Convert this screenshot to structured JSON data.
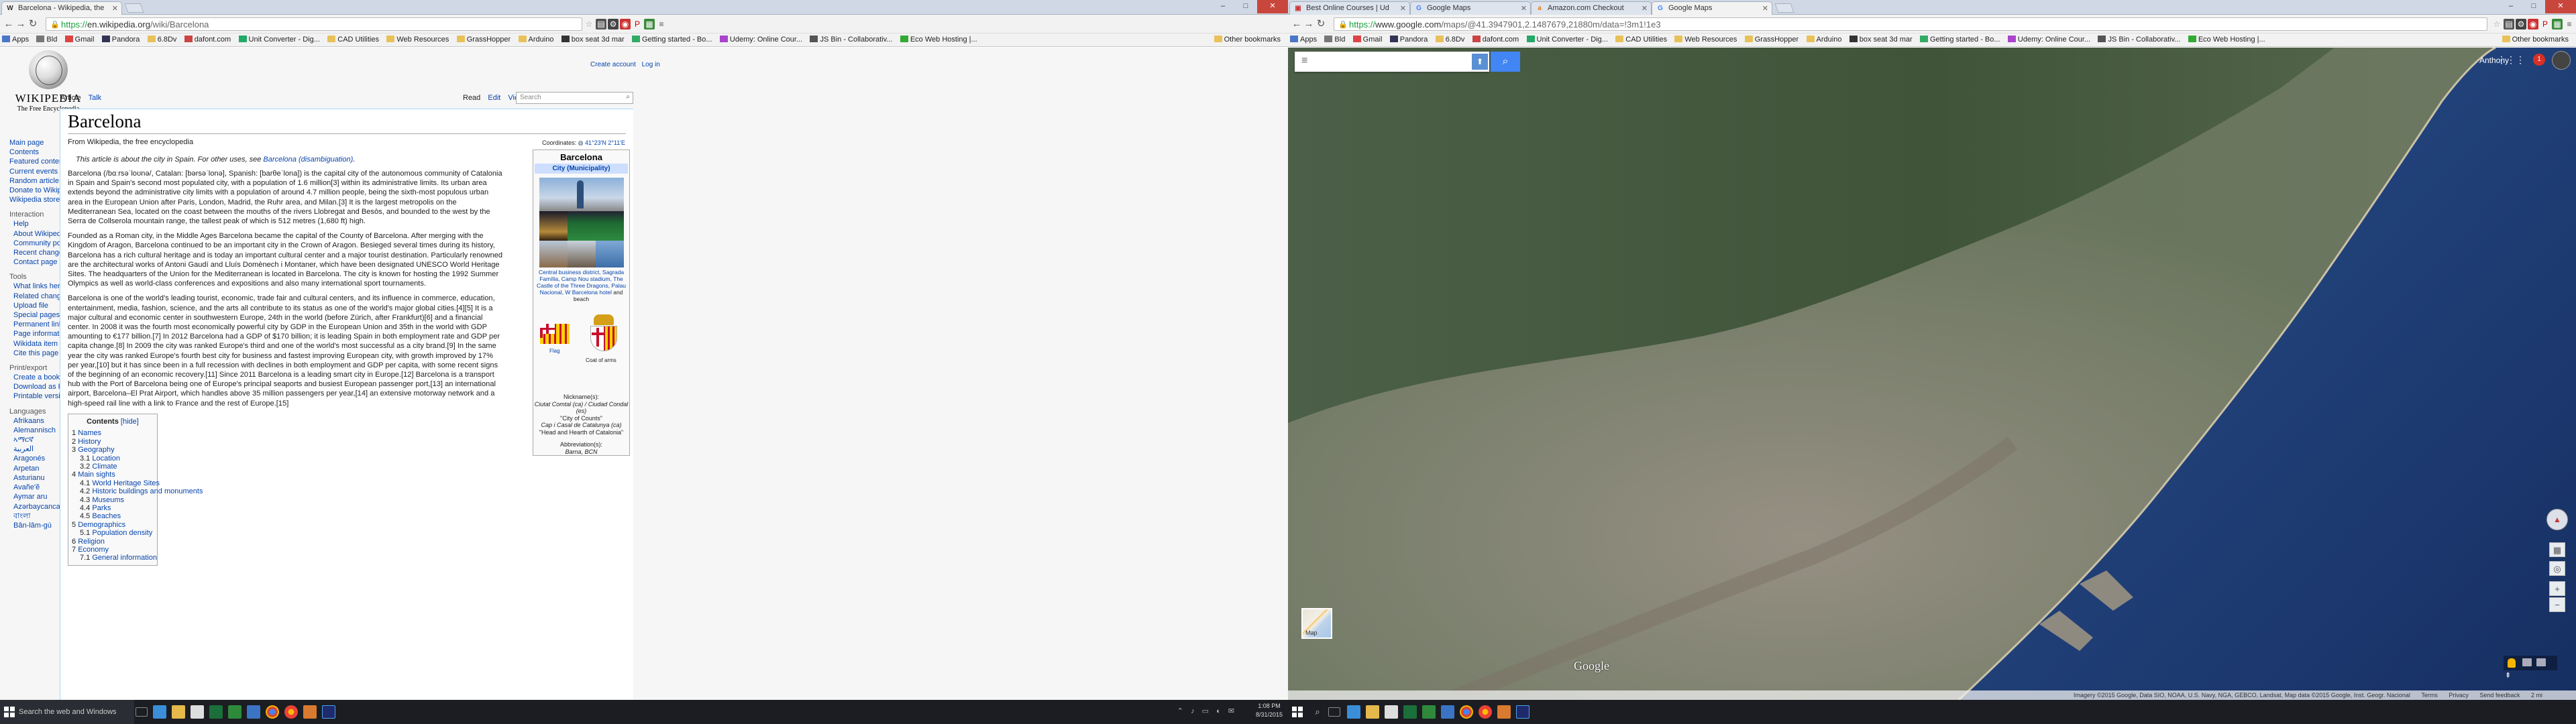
{
  "left_window": {
    "tab": {
      "title": "Barcelona - Wikipedia, the",
      "favicon": "W"
    },
    "window_controls": [
      "–",
      "□",
      "✕"
    ],
    "nav": {
      "back": "←",
      "forward": "→",
      "reload": "↻",
      "home": "⌂"
    },
    "url": {
      "scheme": "https://",
      "host": "en.wikipedia.org",
      "path": "/wiki/Barcelona"
    },
    "bookmarks": [
      "Apps",
      "Bld",
      "Gmail",
      "Pandora",
      "6.8Dv",
      "dafont.com",
      "Unit Converter - Dig...",
      "CAD Utilities",
      "Web Resources",
      "GrassHopper",
      "Arduino",
      "box seat 3d mar",
      "Getting started - Bo...",
      "Udemy: Online Cour...",
      "JS Bin - Collaborativ...",
      "Eco Web Hosting |...",
      "Other bookmarks"
    ],
    "wiki": {
      "logo_wordmark": "WIKIPEDIA",
      "logo_sub": "The Free Encyclopedia",
      "personal": [
        "Create account",
        "Log in"
      ],
      "tabs_left": [
        "Article",
        "Talk"
      ],
      "tabs_right": [
        "Read",
        "Edit",
        "View history"
      ],
      "search_placeholder": "Search",
      "nav_main": [
        "Main page",
        "Contents",
        "Featured content",
        "Current events",
        "Random article",
        "Donate to Wikipedia",
        "Wikipedia store"
      ],
      "interaction_head": "Interaction",
      "nav_interaction": [
        "Help",
        "About Wikipedia",
        "Community portal",
        "Recent changes",
        "Contact page"
      ],
      "tools_head": "Tools",
      "nav_tools": [
        "What links here",
        "Related changes",
        "Upload file",
        "Special pages",
        "Permanent link",
        "Page information",
        "Wikidata item",
        "Cite this page"
      ],
      "print_head": "Print/export",
      "nav_print": [
        "Create a book",
        "Download as PDF",
        "Printable version"
      ],
      "lang_head": "Languages",
      "nav_langs": [
        "Afrikaans",
        "Alemannisch",
        "ኣማርኛ",
        "العربية",
        "Aragonés",
        "Arpetan",
        "Asturianu",
        "Avañe'ẽ",
        "Aymar aru",
        "Azərbaycanca",
        "বাংলা",
        "Bân-lâm-gú"
      ],
      "title": "Barcelona",
      "from": "From Wikipedia, the free encyclopedia",
      "coords_label": "Coordinates:",
      "coords_value": "41°23′N 2°11′E",
      "hatnote_a": "This article is about the city in Spain. For other uses, see ",
      "hatnote_link": "Barcelona (disambiguation)",
      "para1": "Barcelona (/bɑːrsəˈloʊnə/, Catalan: [bərsəˈlonə], Spanish: [barθeˈlona]) is the capital city of the autonomous community of Catalonia in Spain and Spain's second most populated city, with a population of 1.6 million[3] within its administrative limits. Its urban area extends beyond the administrative city limits with a population of around 4.7 million people, being the sixth-most populous urban area in the European Union after Paris, London, Madrid, the Ruhr area, and Milan.[3] It is the largest metropolis on the Mediterranean Sea, located on the coast between the mouths of the rivers Llobregat and Besòs, and bounded to the west by the Serra de Collserola mountain range, the tallest peak of which is 512 metres (1,680 ft) high.",
      "para2": "Founded as a Roman city, in the Middle Ages Barcelona became the capital of the County of Barcelona. After merging with the Kingdom of Aragon, Barcelona continued to be an important city in the Crown of Aragon. Besieged several times during its history, Barcelona has a rich cultural heritage and is today an important cultural center and a major tourist destination. Particularly renowned are the architectural works of Antoni Gaudí and Lluís Domènech i Montaner, which have been designated UNESCO World Heritage Sites. The headquarters of the Union for the Mediterranean is located in Barcelona. The city is known for hosting the 1992 Summer Olympics as well as world-class conferences and expositions and also many international sport tournaments.",
      "para3": "Barcelona is one of the world's leading tourist, economic, trade fair and cultural centers, and its influence in commerce, education, entertainment, media, fashion, science, and the arts all contribute to its status as one of the world's major global cities.[4][5] It is a major cultural and economic center in southwestern Europe, 24th in the world (before Zürich, after Frankfurt)[6] and a financial center. In 2008 it was the fourth most economically powerful city by GDP in the European Union and 35th in the world with GDP amounting to €177 billion.[7] In 2012 Barcelona had a GDP of $170 billion; it is leading Spain in both employment rate and GDP per capita change.[8] In 2009 the city was ranked Europe's third and one of the world's most successful as a city brand.[9] In the same year the city was ranked Europe's fourth best city for business and fastest improving European city, with growth improved by 17% per year,[10] but it has since been in a full recession with declines in both employment and GDP per capita, with some recent signs of the beginning of an economic recovery.[11] Since 2011 Barcelona is a leading smart city in Europe.[12] Barcelona is a transport hub with the Port of Barcelona being one of Europe's principal seaports and busiest European passenger port,[13] an international airport, Barcelona–El Prat Airport, which handles above 35 million passengers per year,[14] an extensive motorway network and a high-speed rail line with a link to France and the rest of Europe.[15]",
      "toc_title": "Contents",
      "toc_hide": "[hide]",
      "toc": [
        {
          "n": "1",
          "t": "Names",
          "lv": 1
        },
        {
          "n": "2",
          "t": "History",
          "lv": 1
        },
        {
          "n": "3",
          "t": "Geography",
          "lv": 1
        },
        {
          "n": "3.1",
          "t": "Location",
          "lv": 2
        },
        {
          "n": "3.2",
          "t": "Climate",
          "lv": 2
        },
        {
          "n": "4",
          "t": "Main sights",
          "lv": 1
        },
        {
          "n": "4.1",
          "t": "World Heritage Sites",
          "lv": 2
        },
        {
          "n": "4.2",
          "t": "Historic buildings and monuments",
          "lv": 2
        },
        {
          "n": "4.3",
          "t": "Museums",
          "lv": 2
        },
        {
          "n": "4.4",
          "t": "Parks",
          "lv": 2
        },
        {
          "n": "4.5",
          "t": "Beaches",
          "lv": 2
        },
        {
          "n": "5",
          "t": "Demographics",
          "lv": 1
        },
        {
          "n": "5.1",
          "t": "Population density",
          "lv": 2
        },
        {
          "n": "6",
          "t": "Religion",
          "lv": 1
        },
        {
          "n": "7",
          "t": "Economy",
          "lv": 1
        },
        {
          "n": "7.1",
          "t": "General information",
          "lv": 2
        }
      ],
      "infobox": {
        "title": "Barcelona",
        "type": "City (Municipality)",
        "caption": "Central business district, Sagrada Família, Camp Nou stadium, The Castle of the Three Dragons, Palau Nacional, W Barcelona hotel",
        "caption_tail": "and beach",
        "flag_label": "Flag",
        "coa_label": "Coat of arms",
        "nick_head": "Nickname(s):",
        "nick1": "Ciutat Comtal (ca) / Ciudad Condal (es)",
        "nick2": "\"City of Counts\"",
        "nick3": "Cap i Casal de Catalunya (ca)",
        "nick4": "\"Head and Hearth of Catalonia\"",
        "abbr_head": "Abbreviation(s):",
        "abbr": "Barna, BCN"
      }
    }
  },
  "right_window": {
    "tabs": [
      {
        "title": "Best Online Courses | Ud",
        "favicon": "▣"
      },
      {
        "title": "Google Maps",
        "favicon": "G"
      },
      {
        "title": "Amazon.com Checkout",
        "favicon": "a"
      },
      {
        "title": "Google Maps",
        "favicon": "G"
      }
    ],
    "url": {
      "scheme": "https://",
      "host": "www.google.com",
      "path": "/maps/@41.3947901,2.1487679,21880m/data=!3m1!1e3"
    },
    "maps": {
      "user": "Anthony",
      "notifications": "1",
      "thumb_label": "Map",
      "watermark": "Google",
      "attribution": "Imagery ©2015 Google, Data SIO, NOAA, U.S. Navy, NGA, GEBCO, Landsat, Map data ©2015 Google, Inst. Geogr. Nacional",
      "footer_links": [
        "Terms",
        "Privacy",
        "Send feedback"
      ],
      "scale": "2 mi",
      "colors": {
        "land": "#5a6e55",
        "city": "#9a8f84",
        "sea": "#1f3f78"
      }
    }
  },
  "taskbar": {
    "search": "Search the web and Windows",
    "time": "1:08 PM",
    "date": "8/31/2015"
  }
}
